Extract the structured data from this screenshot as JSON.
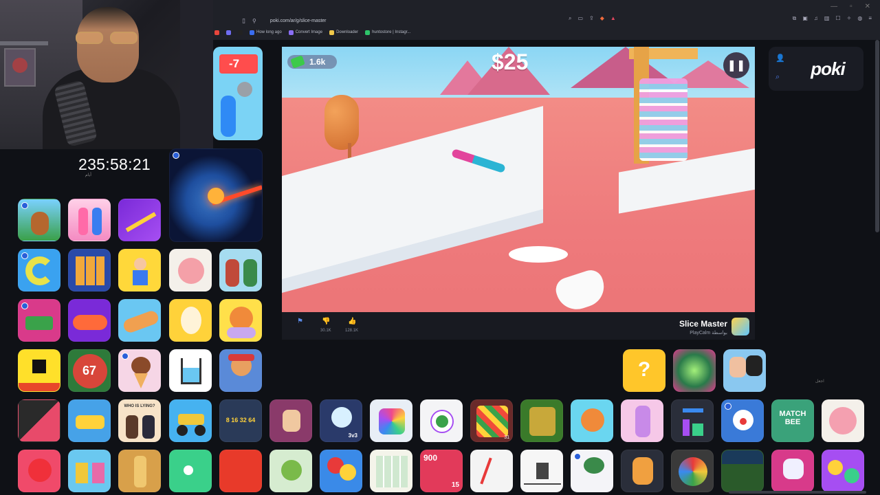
{
  "browser": {
    "url": "poki.com/ar/g/slice-master",
    "window_controls": [
      "—",
      "▫",
      "✕"
    ],
    "bookmarks": [
      "How long ago",
      "Convert Image",
      "Downloader",
      "huntostore | Instagr..."
    ]
  },
  "stream": {
    "timer": "235:58:21",
    "timer_sub": "أيام"
  },
  "game": {
    "money": "1.6k",
    "score": "$25",
    "pause_icon": "pause-icon",
    "title": "Slice Master",
    "developer": "PlayCalm بواسطة",
    "dislikes": "30.1K",
    "likes": "128.1K"
  },
  "side": {
    "logo": "poki",
    "help_text": "اجعل"
  },
  "tiles": [
    {
      "id": "t-7",
      "label": "-7",
      "color": "#ff5a5a",
      "bg": "#7bd3f5"
    },
    {
      "id": "t-earth",
      "label": "",
      "color": "",
      "bg": "#0b1536"
    },
    {
      "id": "t-67",
      "label": "67",
      "color": "",
      "bg": "#d8463a"
    },
    {
      "id": "t-whoislying",
      "label": "WHO IS LYING?",
      "color": "",
      "bg": "#f7e3c8"
    },
    {
      "id": "t-numbers",
      "label": "8 16 32 64",
      "color": "",
      "bg": "#2a3a58"
    },
    {
      "id": "t-900",
      "label": "900",
      "color": "",
      "bg": "#e23a5a"
    },
    {
      "id": "t-matchbee",
      "label": "MATCH BEE",
      "color": "",
      "bg": "#3aa27a"
    },
    {
      "id": "t-3v3",
      "label": "3v3",
      "color": "",
      "bg": "#2f5d9e"
    },
    {
      "id": "t-15",
      "label": "15",
      "color": "",
      "bg": "#e84c3a"
    },
    {
      "id": "t-31",
      "label": "31",
      "color": "",
      "bg": "#6b2a2a"
    }
  ]
}
